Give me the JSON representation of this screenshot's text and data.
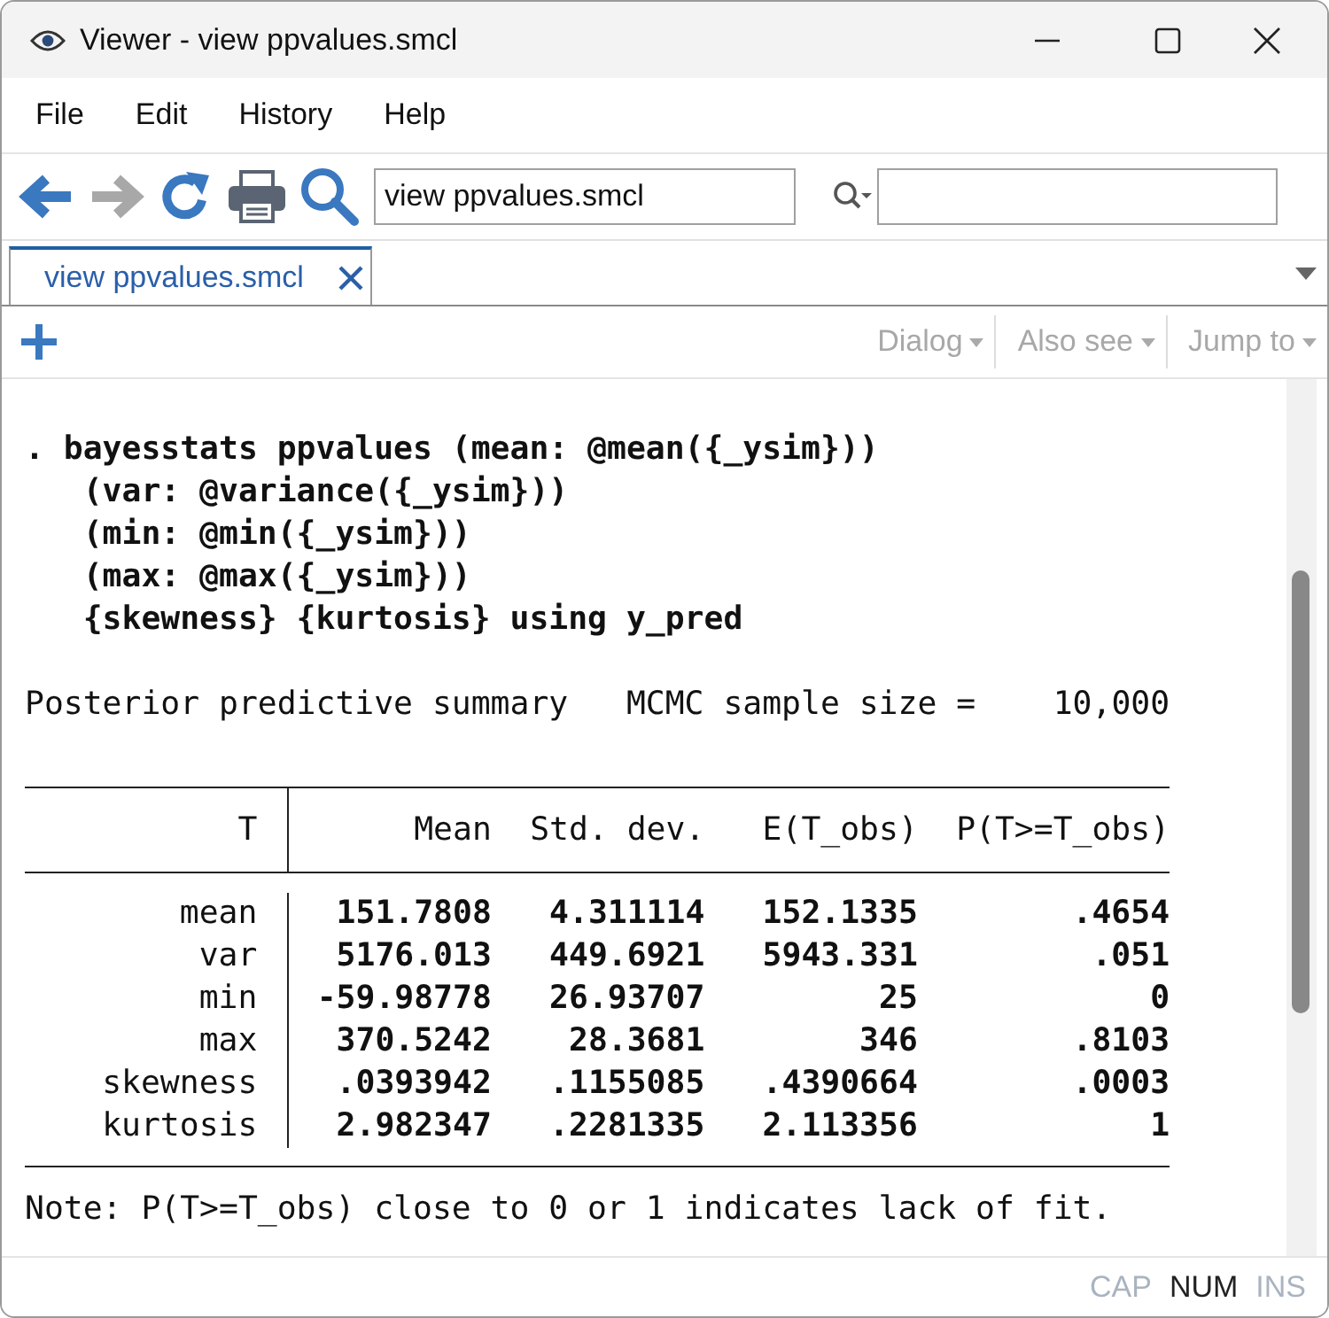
{
  "window": {
    "title": "Viewer - view ppvalues.smcl"
  },
  "menu": [
    "File",
    "Edit",
    "History",
    "Help"
  ],
  "toolbar": {
    "address": {
      "value": "view ppvalues.smcl"
    }
  },
  "tabs": [
    {
      "label": "view ppvalues.smcl",
      "selected": true
    }
  ],
  "viewer_buttons": [
    "Dialog",
    "Also see",
    "Jump to"
  ],
  "content": {
    "command": [
      ". bayesstats ppvalues (mean: @mean({_ysim}))",
      "   (var: @variance({_ysim}))",
      "   (min: @min({_ysim}))",
      "   (max: @max({_ysim}))",
      "   {skewness} {kurtosis} using y_pred"
    ],
    "summary": {
      "title": "Posterior predictive summary",
      "key": "MCMC sample size =",
      "value": "10,000"
    },
    "table": {
      "columns": [
        "T",
        "Mean",
        "Std. dev.",
        "E(T_obs)",
        "P(T>=T_obs)"
      ],
      "rows": [
        [
          "mean",
          "151.7808",
          "4.311114",
          "152.1335",
          ".4654"
        ],
        [
          "var",
          "5176.013",
          "449.6921",
          "5943.331",
          ".051"
        ],
        [
          "min",
          "-59.98778",
          "26.93707",
          "25",
          "0"
        ],
        [
          "max",
          "370.5242",
          "28.3681",
          "346",
          ".8103"
        ],
        [
          "skewness",
          ".0393942",
          ".1155085",
          ".4390664",
          ".0003"
        ],
        [
          "kurtosis",
          "2.982347",
          ".2281335",
          "2.113356",
          "1"
        ]
      ]
    },
    "note": "Note: P(T>=T_obs) close to 0 or 1 indicates lack of fit."
  },
  "status_bar": [
    {
      "label": "CAP",
      "on": false
    },
    {
      "label": "NUM",
      "on": true
    },
    {
      "label": "INS",
      "on": false
    }
  ]
}
